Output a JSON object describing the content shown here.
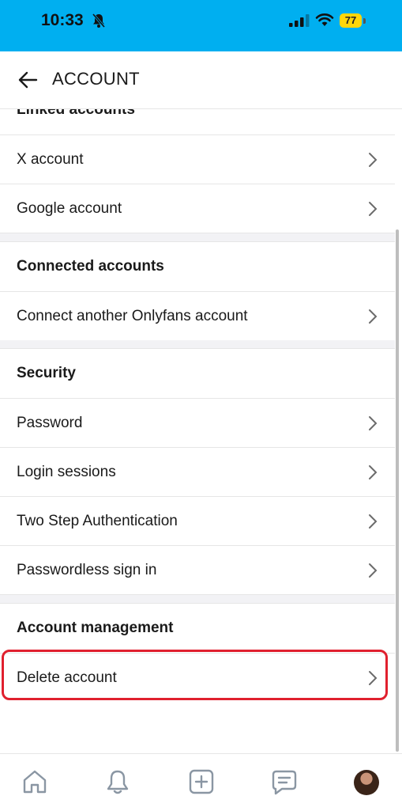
{
  "status_bar": {
    "time": "10:33",
    "battery": "77"
  },
  "header": {
    "title": "ACCOUNT"
  },
  "sections": [
    {
      "title": "Linked accounts",
      "items": [
        "X account",
        "Google account"
      ]
    },
    {
      "title": "Connected accounts",
      "items": [
        "Connect another Onlyfans account"
      ]
    },
    {
      "title": "Security",
      "items": [
        "Password",
        "Login sessions",
        "Two Step Authentication",
        "Passwordless sign in"
      ]
    },
    {
      "title": "Account management",
      "items": [
        "Delete account"
      ]
    }
  ],
  "highlight_color": "#e0202e",
  "brand_color": "#00aff0",
  "bottom_nav": [
    "home-icon",
    "bell-icon",
    "add-post-icon",
    "messages-icon",
    "avatar"
  ]
}
